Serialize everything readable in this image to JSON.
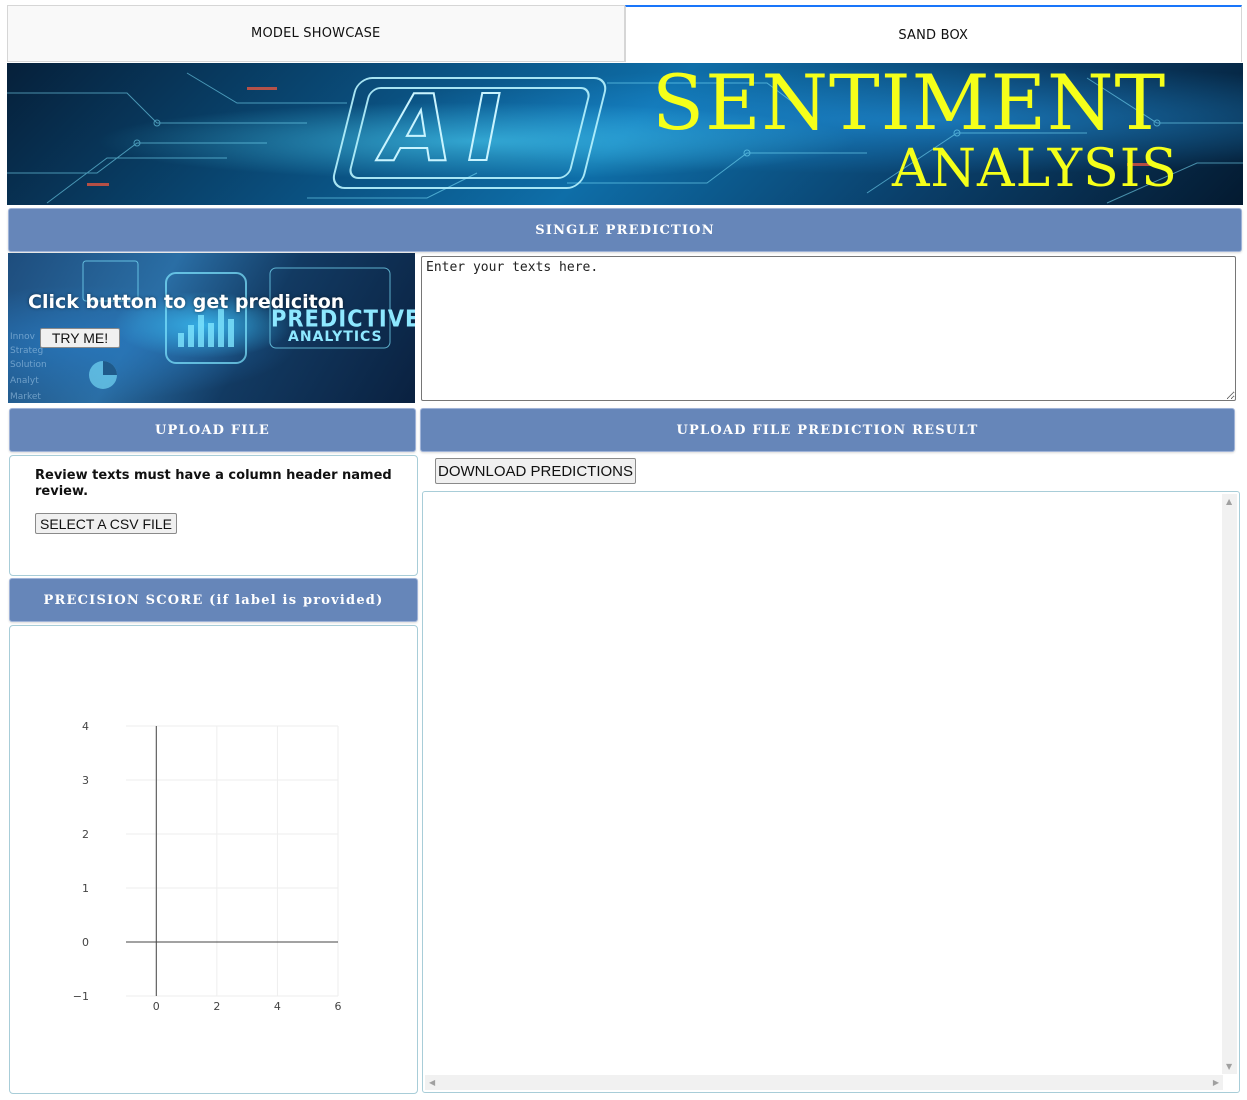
{
  "tabs": [
    {
      "label": "MODEL SHOWCASE",
      "active": false
    },
    {
      "label": "SAND BOX",
      "active": true
    }
  ],
  "banner": {
    "emblem": "AI",
    "title": "SENTIMENT",
    "subtitle": "ANALYSIS",
    "title_color": "#f5ff1a"
  },
  "single_prediction": {
    "header": "SINGLE PREDICTION",
    "image_text_1": "PREDICTIVE",
    "image_text_2": "ANALYTICS",
    "cta": "Click button to get prediciton",
    "button": "TRY ME!",
    "textarea_placeholder": "Enter your texts here."
  },
  "upload": {
    "header": "UPLOAD FILE",
    "note": "Review texts must have a column header named review.",
    "button": "SELECT A CSV FILE"
  },
  "results": {
    "header": "UPLOAD FILE PREDICTION RESULT",
    "download_button": "DOWNLOAD PREDICTIONS"
  },
  "precision": {
    "header": "PRECISION SCORE (if label is provided)"
  },
  "colors": {
    "header_bg": "#6686b9",
    "tab_active_accent": "#1975FA",
    "panel_border": "#a8cdd8"
  },
  "chart_data": {
    "type": "line",
    "series": [],
    "xlim": [
      -1,
      6
    ],
    "ylim": [
      -1,
      4
    ],
    "x_ticks": [
      "0",
      "2",
      "4",
      "6"
    ],
    "y_ticks": [
      "−1",
      "0",
      "1",
      "2",
      "3",
      "4"
    ],
    "grid": true
  }
}
